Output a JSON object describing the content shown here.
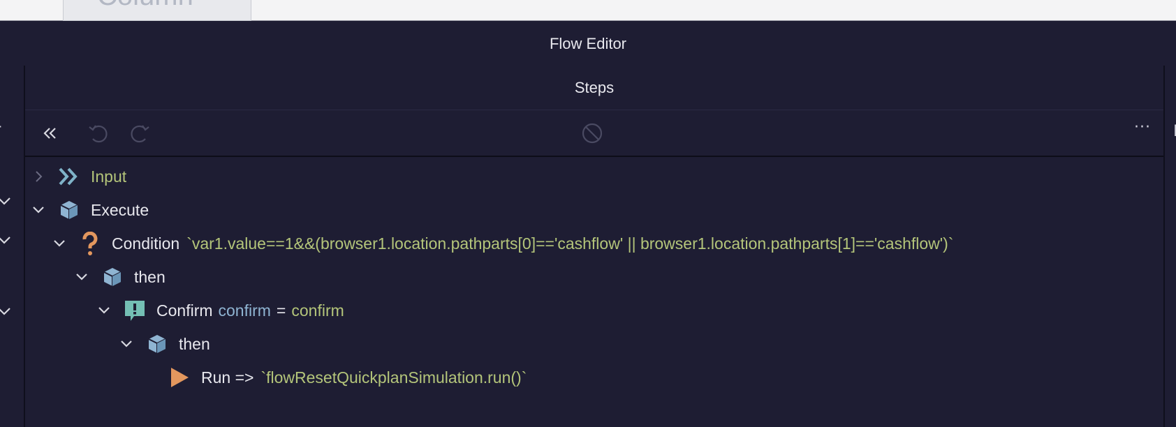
{
  "background_tab": {
    "label": "Column"
  },
  "editor": {
    "title": "Flow Editor"
  },
  "steps": {
    "header": "Steps"
  },
  "toolbar": {
    "collapse_icon": "double-chevron-left-icon",
    "undo_icon": "undo-icon",
    "redo_icon": "redo-icon",
    "disable_icon": "no-entry-icon",
    "more_label": "···"
  },
  "right_panel": {
    "label": "P"
  },
  "tree": [
    {
      "label": "Input",
      "label_color": "green",
      "icon": "double-chevron-right-icon",
      "expanded": false
    },
    {
      "label": "Execute",
      "icon": "cube-icon",
      "expanded": true
    },
    {
      "label": "Condition",
      "icon": "question-icon",
      "expanded": true,
      "expr": "`var1.value==1&&(browser1.location.pathparts[0]=='cashflow' || browser1.location.pathparts[1]=='cashflow')`"
    },
    {
      "label": "then",
      "icon": "cube-icon",
      "expanded": true
    },
    {
      "label": "Confirm",
      "icon": "exclamation-bubble-icon",
      "expanded": true,
      "var": "confirm",
      "op": "=",
      "val": "confirm"
    },
    {
      "label": "then",
      "icon": "cube-icon",
      "expanded": true
    },
    {
      "label": "Run =>",
      "icon": "play-icon",
      "expr": "`flowResetQuickplanSimulation.run()`"
    }
  ]
}
